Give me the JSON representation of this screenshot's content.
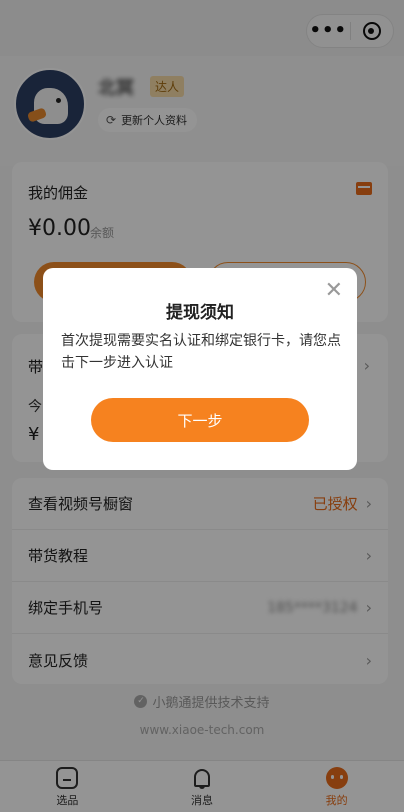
{
  "top_bar": {
    "more_icon": "more-dots-icon",
    "close_icon": "target-icon"
  },
  "profile": {
    "username": "北冥",
    "badge": "达人",
    "update_button": "更新个人资料"
  },
  "commission": {
    "title": "我的佣金",
    "amount": "¥0.00",
    "amount_label": "余额"
  },
  "sales_card": {
    "label_partial": "带",
    "sub_partial": "今",
    "value_partial": "¥"
  },
  "menu": {
    "items": [
      {
        "label": "查看视频号橱窗",
        "status": "已授权"
      },
      {
        "label": "带货教程"
      },
      {
        "label": "绑定手机号",
        "value": "185****3124"
      },
      {
        "label": "意见反馈"
      }
    ]
  },
  "footer": {
    "support": "小鹅通提供技术支持",
    "domain": "www.xiaoe-tech.com"
  },
  "tabbar": {
    "tabs": [
      {
        "label": "选品",
        "icon": "home-icon"
      },
      {
        "label": "消息",
        "icon": "bell-icon"
      },
      {
        "label": "我的",
        "icon": "profile-icon"
      }
    ],
    "active_color": "#e96c1a"
  },
  "modal": {
    "title": "提现须知",
    "body": "首次提现需要实名认证和绑定银行卡，请您点击下一步进入认证",
    "next_button": "下一步",
    "accent": "#f6821f"
  }
}
